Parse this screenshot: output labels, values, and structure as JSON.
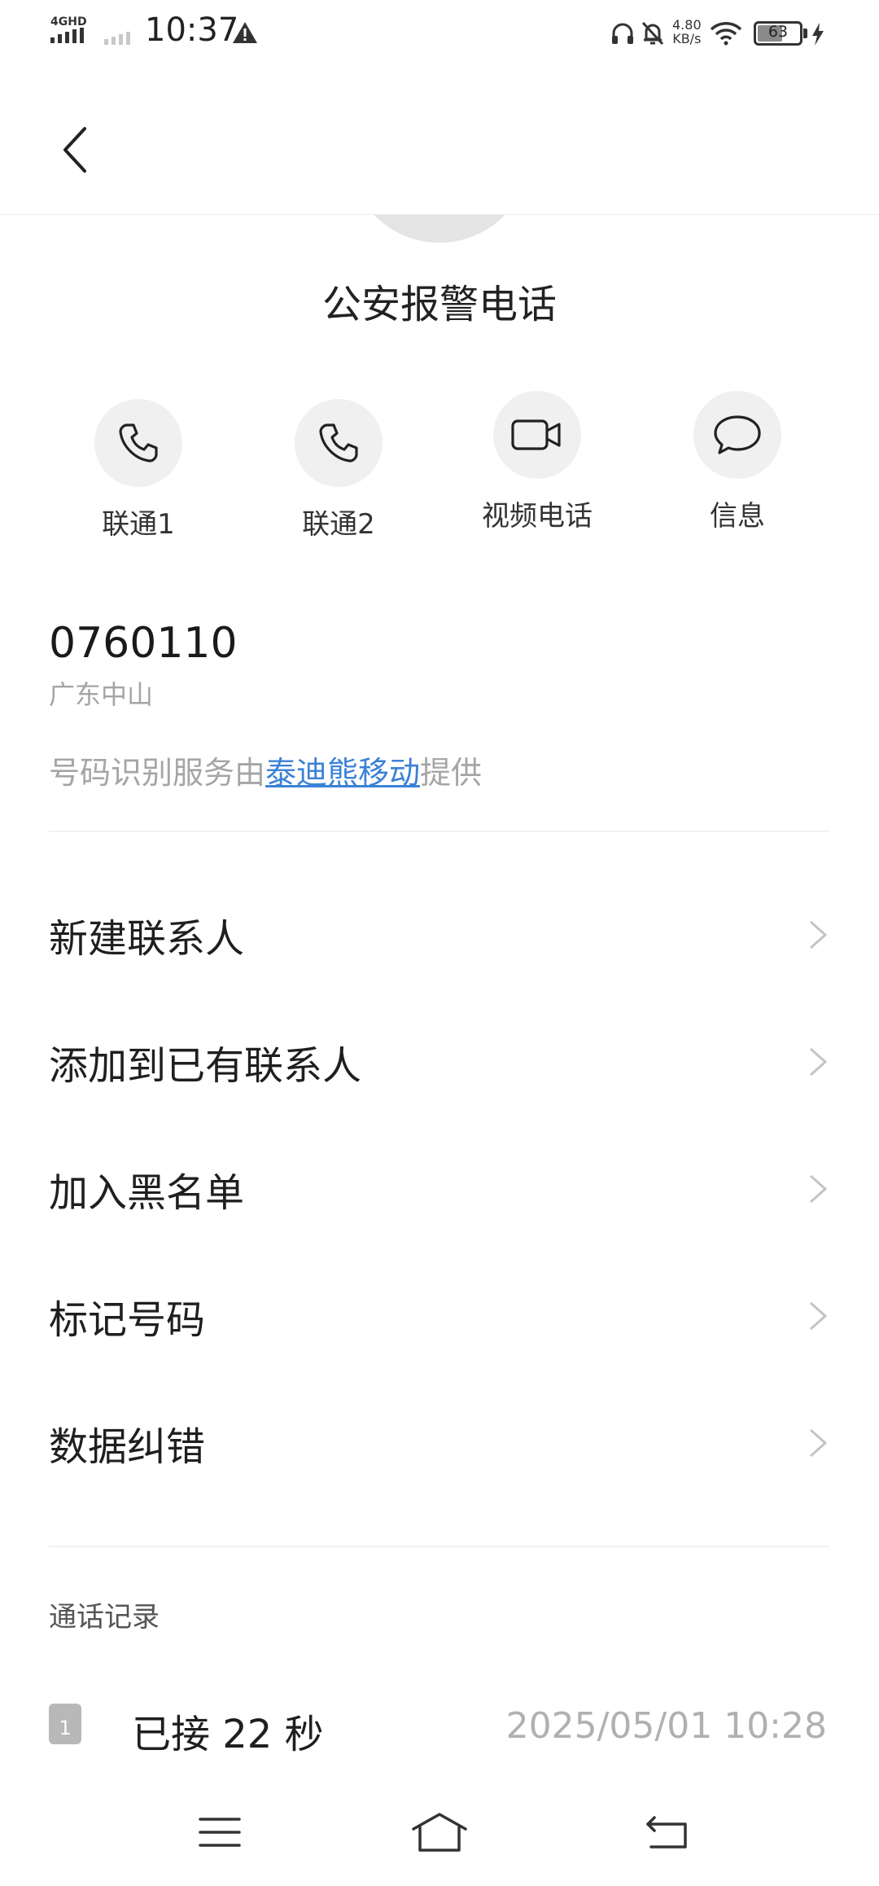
{
  "status_bar": {
    "network": "4GHD",
    "time": "10:37",
    "speed_value": "4.80",
    "speed_unit": "KB/s",
    "battery": 63
  },
  "contact": {
    "name": "公安报警电话"
  },
  "actions": [
    {
      "label": "联通1",
      "icon": "phone-icon"
    },
    {
      "label": "联通2",
      "icon": "phone-icon"
    },
    {
      "label": "视频电话",
      "icon": "video-camera-icon"
    },
    {
      "label": "信息",
      "icon": "message-bubble-icon"
    }
  ],
  "number_info": {
    "number": "0760110",
    "region": "广东中山",
    "provider_prefix": "号码识别服务由",
    "provider_link": "泰迪熊移动",
    "provider_suffix": "提供"
  },
  "menu": [
    {
      "label": "新建联系人"
    },
    {
      "label": "添加到已有联系人"
    },
    {
      "label": "加入黑名单"
    },
    {
      "label": "标记号码"
    },
    {
      "label": "数据纠错"
    }
  ],
  "call_log": {
    "title": "通话记录",
    "entries": [
      {
        "sim": "1",
        "type": "已接 22 秒",
        "datetime": "2025/05/01 10:28"
      }
    ]
  },
  "colors": {
    "link": "#3b82d6",
    "muted": "#a5a5a5",
    "icon_bg": "#f0f0f0"
  }
}
